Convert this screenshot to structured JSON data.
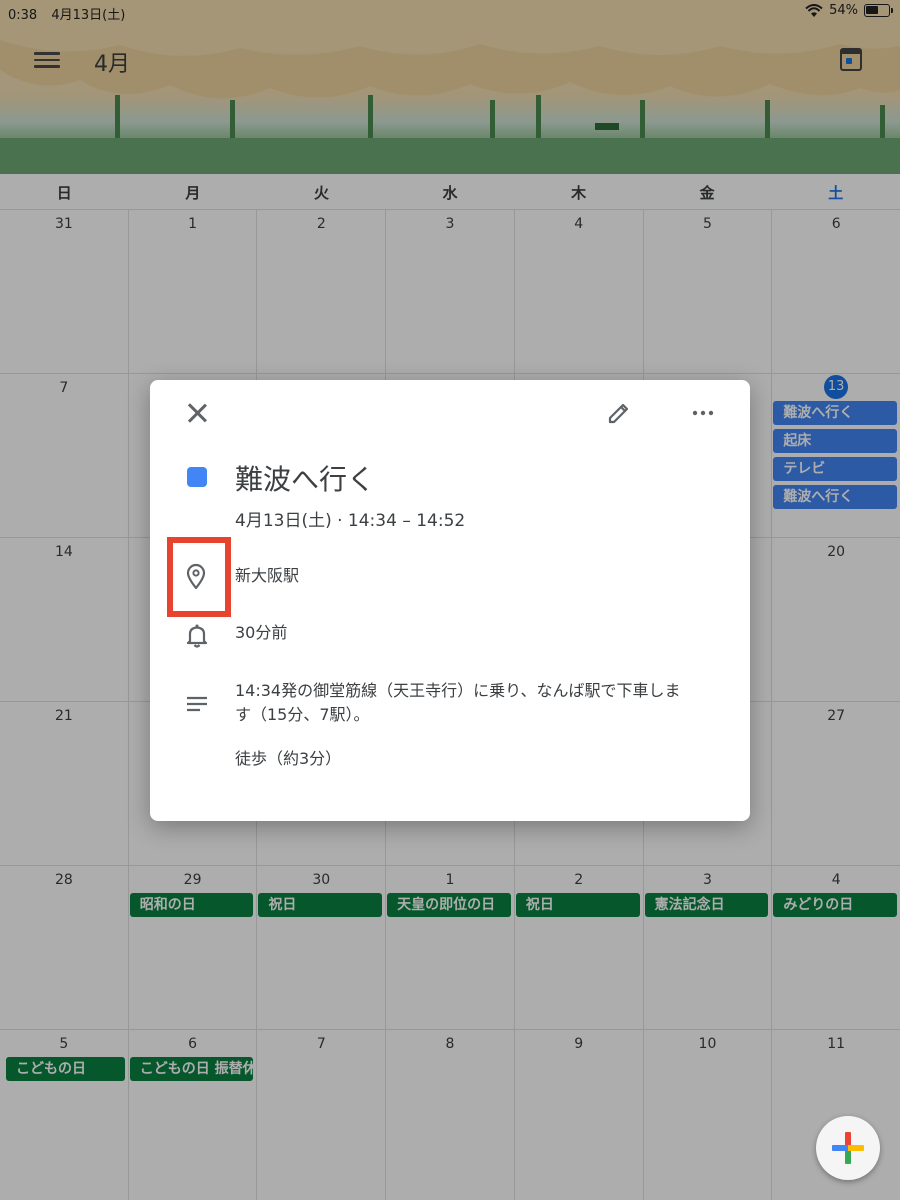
{
  "status_bar": {
    "time": "0:38",
    "date": "4月13日(土)",
    "battery": "54%"
  },
  "header": {
    "month": "4月"
  },
  "weekdays": [
    "日",
    "月",
    "火",
    "水",
    "木",
    "金",
    "土"
  ],
  "weeks": [
    {
      "days": [
        "31",
        "1",
        "2",
        "3",
        "4",
        "5",
        "6"
      ]
    },
    {
      "days": [
        "7",
        "",
        "",
        "",
        "",
        "",
        "13"
      ]
    },
    {
      "days": [
        "14",
        "",
        "",
        "",
        "",
        "",
        "20"
      ]
    },
    {
      "days": [
        "21",
        "",
        "",
        "",
        "",
        "",
        "27"
      ]
    },
    {
      "days": [
        "28",
        "29",
        "30",
        "1",
        "2",
        "3",
        "4"
      ]
    },
    {
      "days": [
        "5",
        "6",
        "7",
        "8",
        "9",
        "10",
        "11"
      ]
    }
  ],
  "today_events": [
    "難波へ行く",
    "起床",
    "テレビ",
    "難波へ行く"
  ],
  "holidays_week5": [
    "昭和の日",
    "祝日",
    "天皇の即位の日",
    "祝日",
    "憲法記念日",
    "みどりの日"
  ],
  "holidays_week6": [
    "こどもの日",
    "こどもの日 振替休日"
  ],
  "dialog": {
    "title": "難波へ行く",
    "time": "4月13日(土) · 14:34 – 14:52",
    "location": "新大阪駅",
    "reminder": "30分前",
    "description_line1": "14:34発の御堂筋線（天王寺行）に乗り、なんば駅で下車しま",
    "description_line2": "す（15分、7駅）。",
    "description_line3": "徒歩（約3分）"
  },
  "colors": {
    "accent": "#1a73e8",
    "event_blue": "#4285f4",
    "holiday_green": "#0b8043",
    "highlight_red": "#e8432e"
  }
}
